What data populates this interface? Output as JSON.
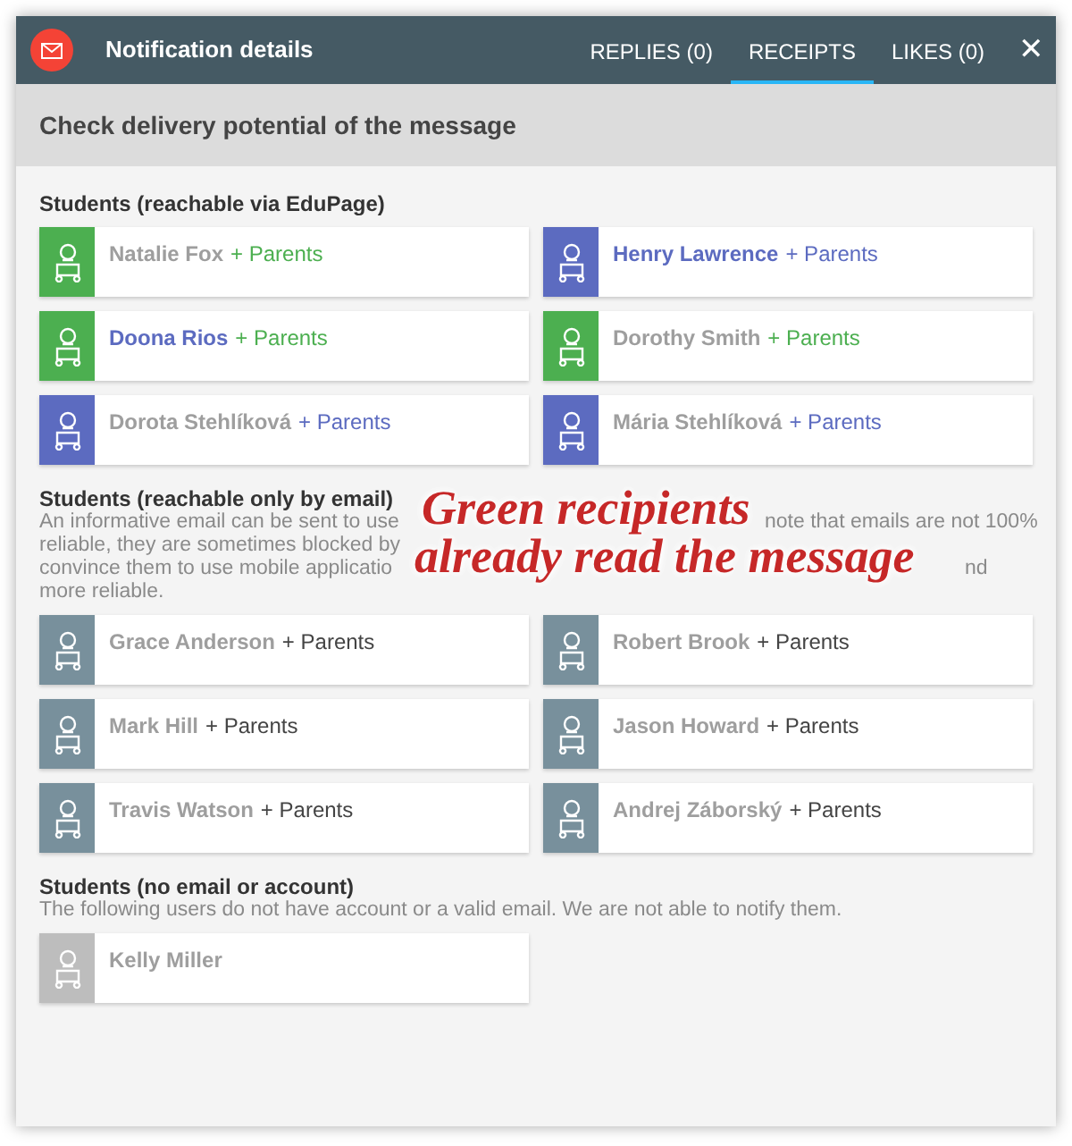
{
  "window": {
    "title": "Notification details",
    "close": "✕"
  },
  "tabs": [
    {
      "label": "REPLIES (0)",
      "selected": false
    },
    {
      "label": "RECEIPTS",
      "selected": true
    },
    {
      "label": "LIKES (0)",
      "selected": false
    }
  ],
  "heading": "Check delivery potential of the message",
  "sections": [
    {
      "title": "Students (reachable via EduPage)",
      "students": [
        {
          "name": "Natalie Fox",
          "suffix": "+ Parents",
          "color": "#4caf50",
          "highlighted": false
        },
        {
          "name": "Henry Lawrence",
          "suffix": "+ Parents",
          "color": "#5c6bc0",
          "highlighted": true
        },
        {
          "name": "Doona Rios",
          "suffix": "+ Parents",
          "color": "#4caf50",
          "highlighted": true
        },
        {
          "name": "Dorothy Smith",
          "suffix": "+ Parents",
          "color": "#4caf50",
          "highlighted": false
        },
        {
          "name": "Dorota Stehlíková",
          "suffix": "+ Parents",
          "color": "#5c6bc0",
          "highlighted": false
        },
        {
          "name": "Mária Stehlíková",
          "suffix": "+ Parents",
          "color": "#5c6bc0",
          "highlighted": false
        }
      ]
    },
    {
      "title": "Students (reachable only by email)",
      "note_lines": [
        [
          "An informative email can be sent to use",
          "note that emails are not 100%"
        ],
        [
          "reliable, they are sometimes blocked by"
        ],
        [
          "convince them to use mobile applicatio",
          "nd"
        ],
        [
          "more reliable."
        ]
      ],
      "students": [
        {
          "name": "Grace Anderson",
          "suffix": "+ Parents",
          "color": "#78909c",
          "highlighted": false
        },
        {
          "name": "Robert Brook",
          "suffix": "+ Parents",
          "color": "#78909c",
          "highlighted": false
        },
        {
          "name": "Mark Hill",
          "suffix": "+ Parents",
          "color": "#78909c",
          "highlighted": false
        },
        {
          "name": "Jason Howard",
          "suffix": "+ Parents",
          "color": "#78909c",
          "highlighted": false
        },
        {
          "name": "Travis Watson",
          "suffix": "+ Parents",
          "color": "#78909c",
          "highlighted": false
        },
        {
          "name": "Andrej Záborský",
          "suffix": "+ Parents",
          "color": "#78909c",
          "highlighted": false
        }
      ]
    },
    {
      "title": "Students (no email or account)",
      "note_lines": [
        [
          "The following users do not have account or a valid email. We are not able to notify them."
        ]
      ],
      "students": [
        {
          "name": "Kelly Miller",
          "color": "#bdbdbd",
          "highlighted": false
        }
      ]
    }
  ],
  "annotation": {
    "lines": [
      "Green recipients",
      "already read the message"
    ]
  }
}
